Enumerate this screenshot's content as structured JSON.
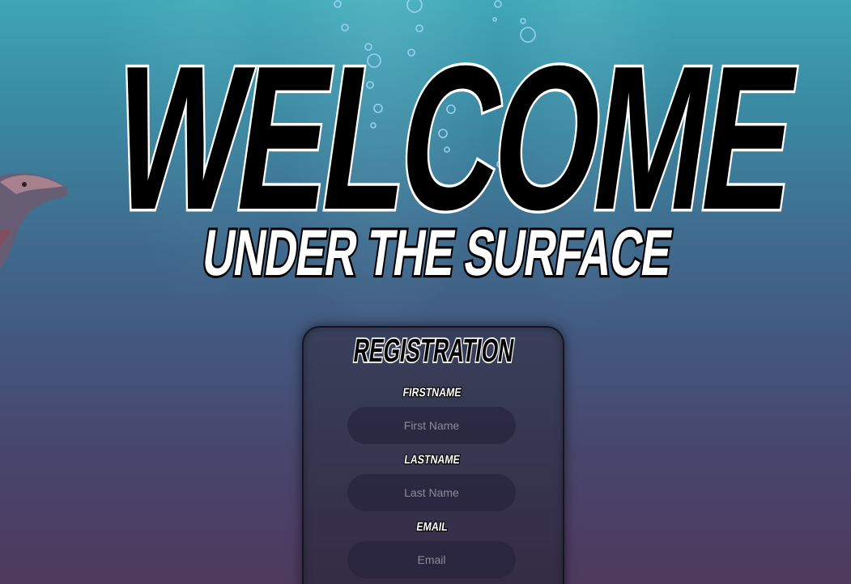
{
  "hero": {
    "title": "WELCOME",
    "subtitle": "UNDER THE SURFACE"
  },
  "form": {
    "heading": "REGISTRATION",
    "fields": [
      {
        "label": "FIRSTNAME",
        "placeholder": "First Name"
      },
      {
        "label": "LASTNAME",
        "placeholder": "Last Name"
      },
      {
        "label": "EMAIL",
        "placeholder": "Email"
      }
    ]
  },
  "colors": {
    "title_fill": "#000000",
    "subtitle_fill": "#ffffff",
    "outline": "#ffffff"
  }
}
